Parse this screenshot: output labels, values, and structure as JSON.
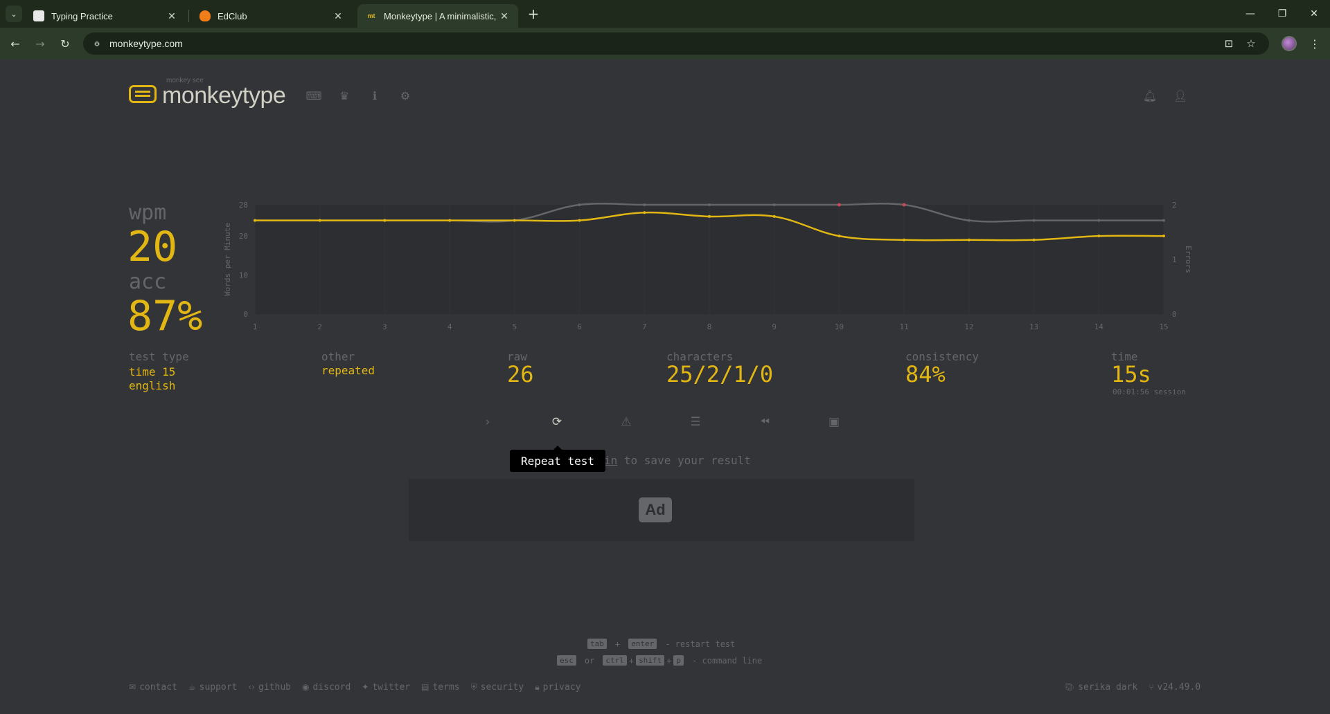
{
  "browser": {
    "tabs": [
      {
        "title": "Typing Practice",
        "favicon": "page-icon"
      },
      {
        "title": "EdClub",
        "favicon": "flame-icon"
      },
      {
        "title": "Monkeytype | A minimalistic, cu",
        "favicon": "mt-icon",
        "favicon_text": "mt"
      }
    ],
    "url": "monkeytype.com"
  },
  "header": {
    "logo_top": "monkey see",
    "logo_text": "monkeytype"
  },
  "result": {
    "wpm_label": "wpm",
    "wpm": "20",
    "acc_label": "acc",
    "acc": "87%",
    "test_type_label": "test type",
    "test_type_1": "time 15",
    "test_type_2": "english",
    "other_label": "other",
    "other": "repeated",
    "raw_label": "raw",
    "raw": "26",
    "characters_label": "characters",
    "characters": "25/2/1/0",
    "consistency_label": "consistency",
    "consistency": "84%",
    "time_label": "time",
    "time": "15s",
    "session": "00:01:56 session"
  },
  "chart_data": {
    "type": "line",
    "x": [
      1,
      2,
      3,
      4,
      5,
      6,
      7,
      8,
      9,
      10,
      11,
      12,
      13,
      14,
      15
    ],
    "series": [
      {
        "values": [
          24,
          24,
          24,
          24,
          24,
          28,
          28,
          28,
          28,
          28,
          28,
          24,
          24,
          24,
          24
        ],
        "color": "#646669"
      },
      {
        "values": [
          24,
          24,
          24,
          24,
          24,
          24,
          26,
          25,
          25,
          20,
          19,
          19,
          19,
          20,
          20
        ],
        "color": "#e2b714"
      }
    ],
    "errors": [
      {
        "x": 10,
        "y": 28
      },
      {
        "x": 11,
        "y": 28
      }
    ],
    "ylabel": "Words per Minute",
    "y2label": "Errors",
    "ylim": [
      0,
      28
    ],
    "yticks": [
      "28",
      "20",
      "10",
      "0"
    ],
    "y2ticks": [
      "2",
      "1",
      "0"
    ],
    "xticks": [
      "1",
      "2",
      "3",
      "4",
      "5",
      "6",
      "7",
      "8",
      "9",
      "10",
      "11",
      "12",
      "13",
      "14",
      "15"
    ],
    "grid": true
  },
  "actions": {
    "tooltip": "Repeat test",
    "login_hidden": "in",
    "login_rest": " to save your result",
    "ad": "Ad"
  },
  "hints": {
    "tab": "tab",
    "plus": "+",
    "enter": "enter",
    "restart": "- restart test",
    "esc": "esc",
    "or": "or",
    "ctrl": "ctrl",
    "shift": "shift",
    "p": "p",
    "command": "- command line"
  },
  "footer": {
    "links": [
      "contact",
      "support",
      "github",
      "discord",
      "twitter",
      "terms",
      "security",
      "privacy"
    ],
    "theme": "serika dark",
    "version": "v24.49.0"
  }
}
